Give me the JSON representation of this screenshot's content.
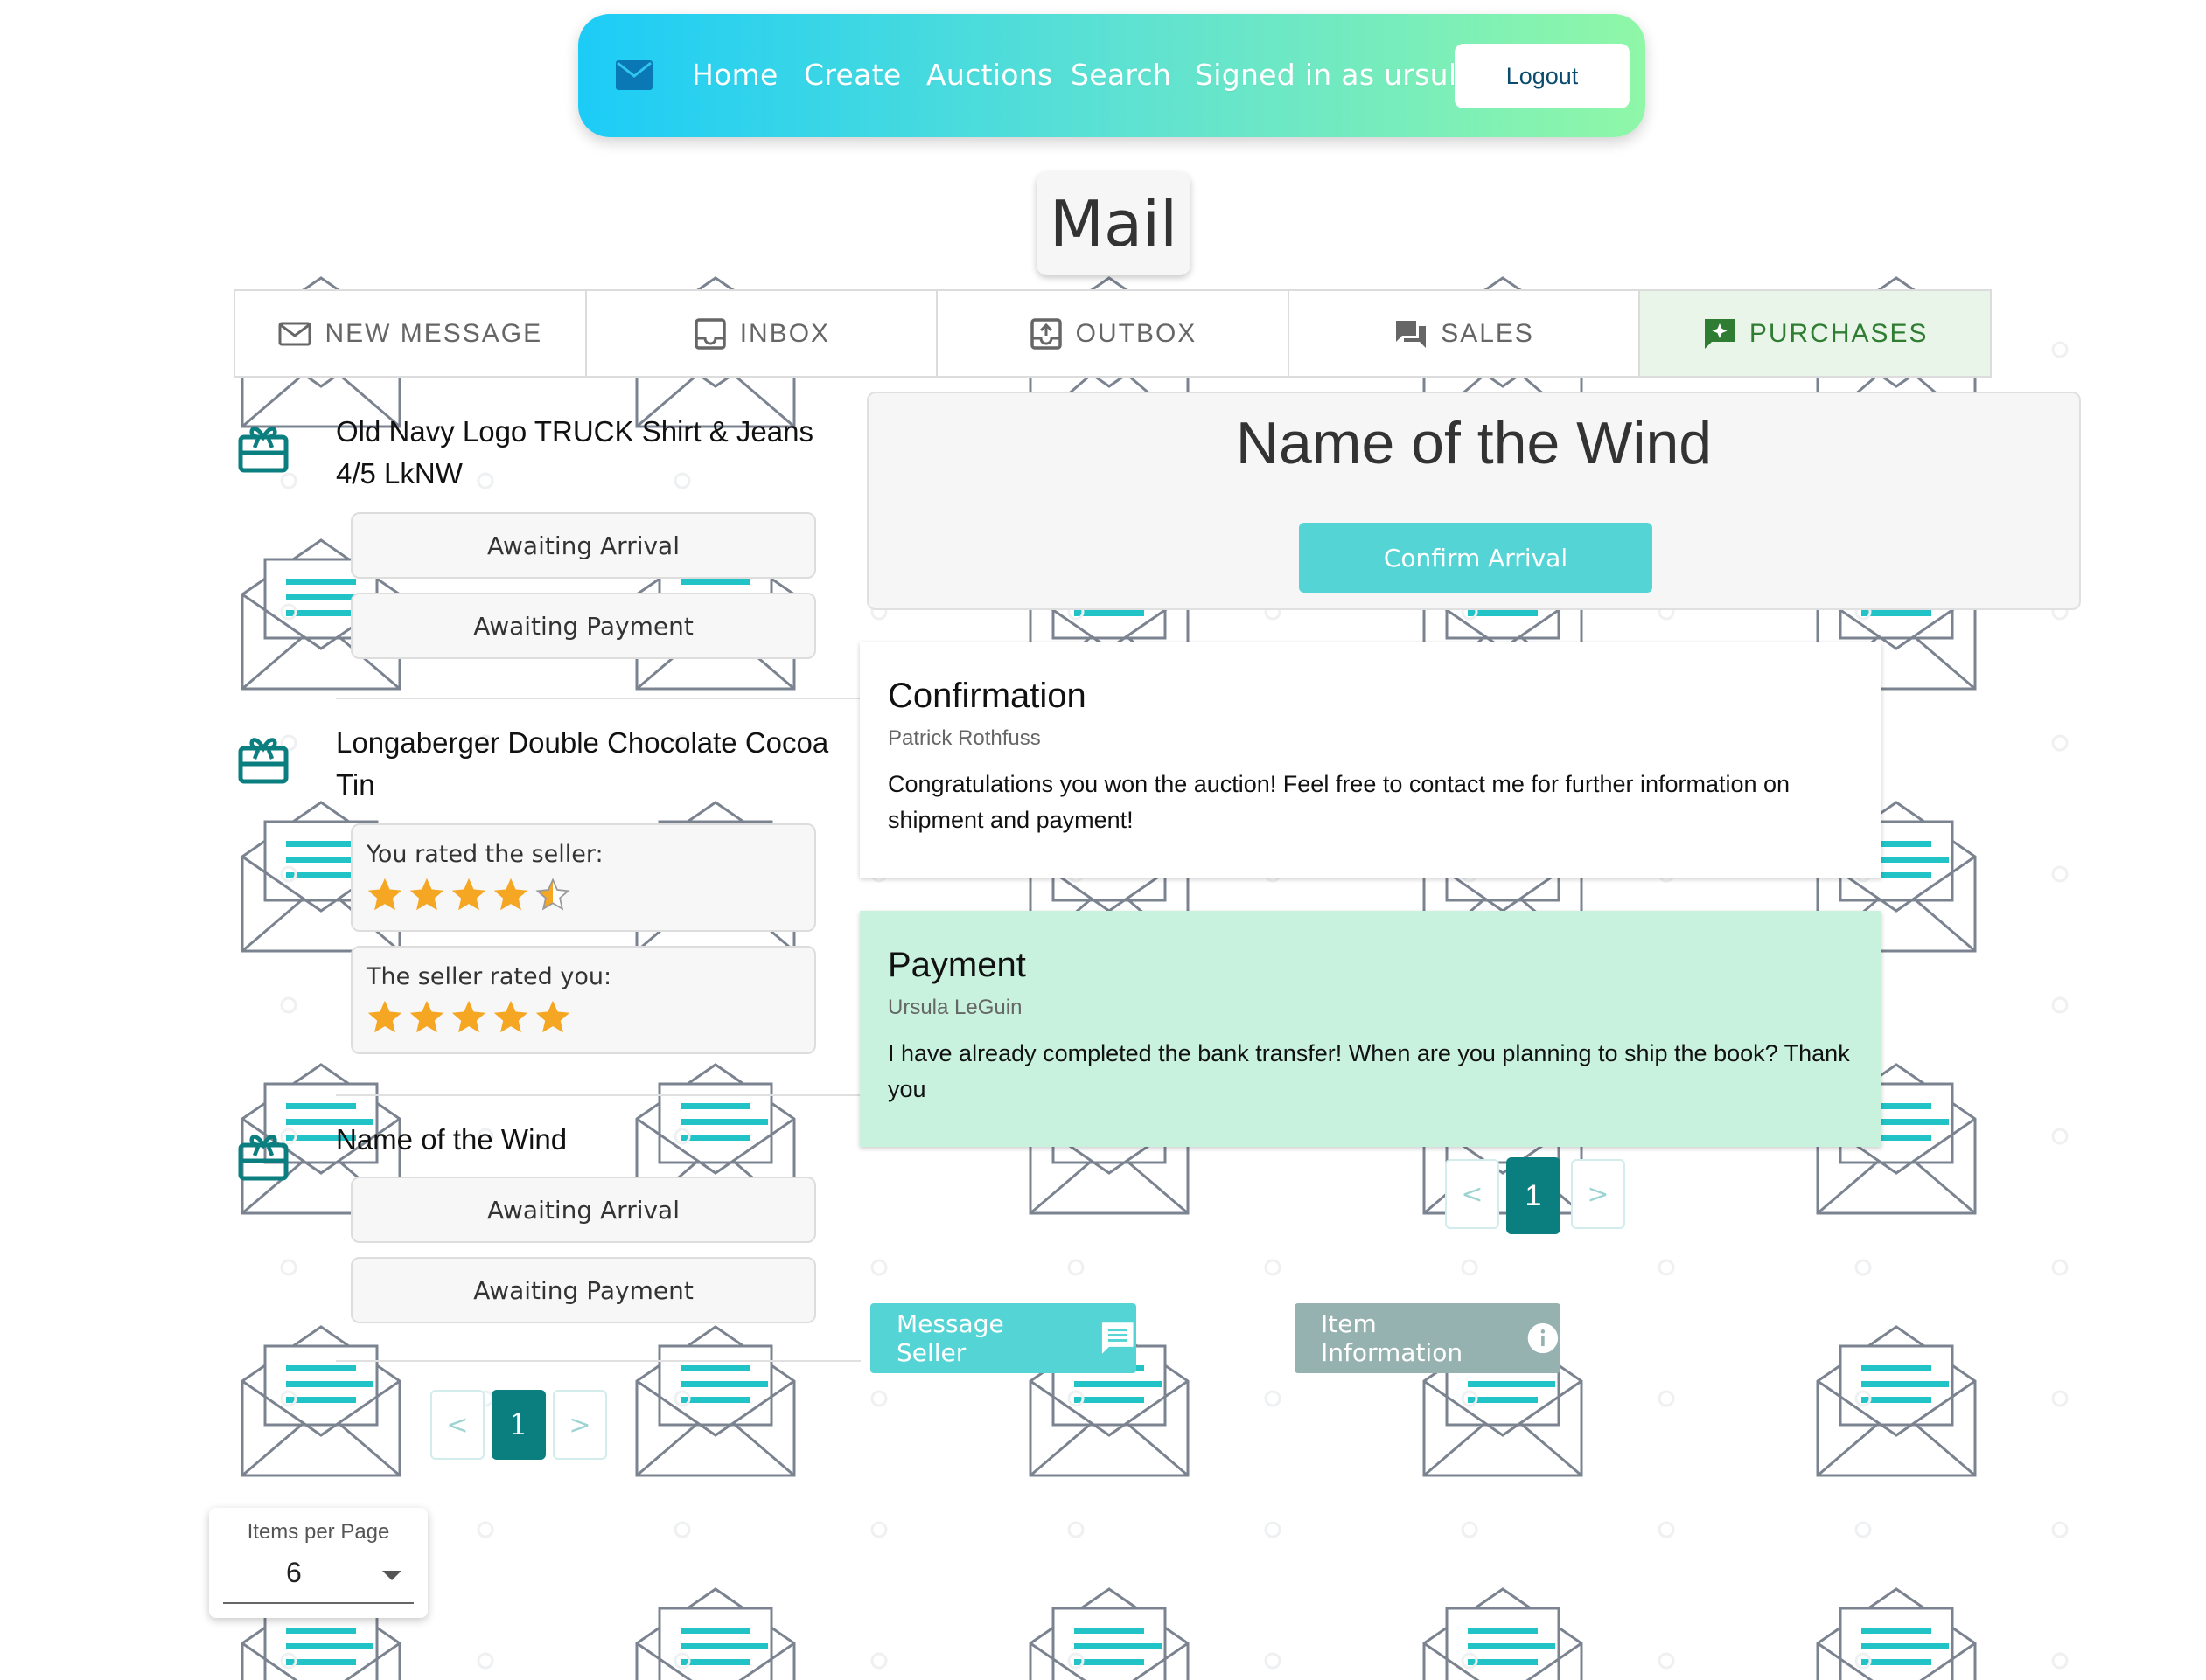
{
  "nav": {
    "home": "Home",
    "create": "Create",
    "auctions": "Auctions",
    "search": "Search",
    "signed_in": "Signed in as ursula",
    "logout": "Logout",
    "icon": "mail-icon"
  },
  "page": {
    "title": "Mail"
  },
  "tabs": [
    {
      "label": "NEW MESSAGE",
      "icon": "envelope-outline-icon"
    },
    {
      "label": "INBOX",
      "icon": "inbox-icon"
    },
    {
      "label": "OUTBOX",
      "icon": "outbox-icon"
    },
    {
      "label": "SALES",
      "icon": "forum-icon"
    },
    {
      "label": "PURCHASES",
      "icon": "sparkle-chat-icon",
      "active": true
    }
  ],
  "purchases": [
    {
      "title": "Old Navy Logo TRUCK Shirt & Jeans 4/5 LkNW",
      "status1": "Awaiting Arrival",
      "status2": "Awaiting Payment"
    },
    {
      "title": "Longaberger Double Chocolate Cocoa Tin",
      "rated_seller_label": "You rated the seller:",
      "rated_seller_stars": 4.5,
      "seller_rated_label": "The seller rated you:",
      "seller_rated_stars": 5
    },
    {
      "title": "Name of the Wind",
      "status1": "Awaiting Arrival",
      "status2": "Awaiting Payment"
    }
  ],
  "left_pager": {
    "prev": "<",
    "current": "1",
    "next": ">"
  },
  "items_per_page": {
    "label": "Items per Page",
    "value": "6"
  },
  "detail": {
    "title": "Name of the Wind",
    "confirm_label": "Confirm Arrival"
  },
  "messages": [
    {
      "subject": "Confirmation",
      "sender": "Patrick Rothfuss",
      "body": "Congratulations you won the auction! Feel free to contact me for further information on shipment and payment!"
    },
    {
      "subject": "Payment",
      "sender": "Ursula LeGuin",
      "body": "I have already completed the bank transfer! When are you planning to ship the book? Thank you"
    }
  ],
  "message_pager": {
    "prev": "<",
    "current": "1",
    "next": ">"
  },
  "actions": {
    "message_seller": "Message Seller",
    "item_information": "Item Information"
  },
  "colors": {
    "accent_teal": "#55d4d6",
    "dark_teal": "#0b7f80",
    "star": "#f5a623",
    "active_tab": "#2e7d32",
    "message_highlight": "#c8f2de"
  }
}
